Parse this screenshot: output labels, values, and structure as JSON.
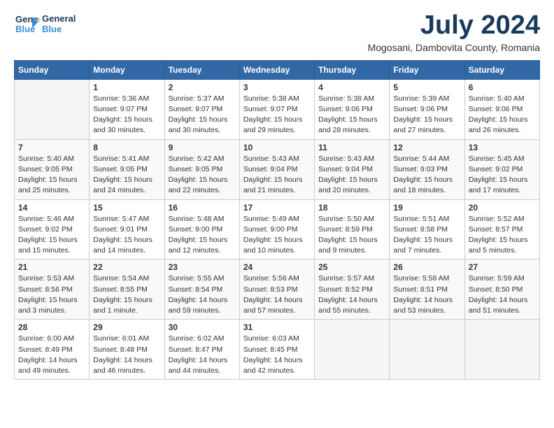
{
  "logo": {
    "line1": "General",
    "line2": "Blue"
  },
  "title": "July 2024",
  "subtitle": "Mogosani, Dambovita County, Romania",
  "days_of_week": [
    "Sunday",
    "Monday",
    "Tuesday",
    "Wednesday",
    "Thursday",
    "Friday",
    "Saturday"
  ],
  "weeks": [
    [
      {
        "day": "",
        "info": ""
      },
      {
        "day": "1",
        "info": "Sunrise: 5:36 AM\nSunset: 9:07 PM\nDaylight: 15 hours\nand 30 minutes."
      },
      {
        "day": "2",
        "info": "Sunrise: 5:37 AM\nSunset: 9:07 PM\nDaylight: 15 hours\nand 30 minutes."
      },
      {
        "day": "3",
        "info": "Sunrise: 5:38 AM\nSunset: 9:07 PM\nDaylight: 15 hours\nand 29 minutes."
      },
      {
        "day": "4",
        "info": "Sunrise: 5:38 AM\nSunset: 9:06 PM\nDaylight: 15 hours\nand 28 minutes."
      },
      {
        "day": "5",
        "info": "Sunrise: 5:39 AM\nSunset: 9:06 PM\nDaylight: 15 hours\nand 27 minutes."
      },
      {
        "day": "6",
        "info": "Sunrise: 5:40 AM\nSunset: 9:06 PM\nDaylight: 15 hours\nand 26 minutes."
      }
    ],
    [
      {
        "day": "7",
        "info": "Sunrise: 5:40 AM\nSunset: 9:05 PM\nDaylight: 15 hours\nand 25 minutes."
      },
      {
        "day": "8",
        "info": "Sunrise: 5:41 AM\nSunset: 9:05 PM\nDaylight: 15 hours\nand 24 minutes."
      },
      {
        "day": "9",
        "info": "Sunrise: 5:42 AM\nSunset: 9:05 PM\nDaylight: 15 hours\nand 22 minutes."
      },
      {
        "day": "10",
        "info": "Sunrise: 5:43 AM\nSunset: 9:04 PM\nDaylight: 15 hours\nand 21 minutes."
      },
      {
        "day": "11",
        "info": "Sunrise: 5:43 AM\nSunset: 9:04 PM\nDaylight: 15 hours\nand 20 minutes."
      },
      {
        "day": "12",
        "info": "Sunrise: 5:44 AM\nSunset: 9:03 PM\nDaylight: 15 hours\nand 18 minutes."
      },
      {
        "day": "13",
        "info": "Sunrise: 5:45 AM\nSunset: 9:02 PM\nDaylight: 15 hours\nand 17 minutes."
      }
    ],
    [
      {
        "day": "14",
        "info": "Sunrise: 5:46 AM\nSunset: 9:02 PM\nDaylight: 15 hours\nand 15 minutes."
      },
      {
        "day": "15",
        "info": "Sunrise: 5:47 AM\nSunset: 9:01 PM\nDaylight: 15 hours\nand 14 minutes."
      },
      {
        "day": "16",
        "info": "Sunrise: 5:48 AM\nSunset: 9:00 PM\nDaylight: 15 hours\nand 12 minutes."
      },
      {
        "day": "17",
        "info": "Sunrise: 5:49 AM\nSunset: 9:00 PM\nDaylight: 15 hours\nand 10 minutes."
      },
      {
        "day": "18",
        "info": "Sunrise: 5:50 AM\nSunset: 8:59 PM\nDaylight: 15 hours\nand 9 minutes."
      },
      {
        "day": "19",
        "info": "Sunrise: 5:51 AM\nSunset: 8:58 PM\nDaylight: 15 hours\nand 7 minutes."
      },
      {
        "day": "20",
        "info": "Sunrise: 5:52 AM\nSunset: 8:57 PM\nDaylight: 15 hours\nand 5 minutes."
      }
    ],
    [
      {
        "day": "21",
        "info": "Sunrise: 5:53 AM\nSunset: 8:56 PM\nDaylight: 15 hours\nand 3 minutes."
      },
      {
        "day": "22",
        "info": "Sunrise: 5:54 AM\nSunset: 8:55 PM\nDaylight: 15 hours\nand 1 minute."
      },
      {
        "day": "23",
        "info": "Sunrise: 5:55 AM\nSunset: 8:54 PM\nDaylight: 14 hours\nand 59 minutes."
      },
      {
        "day": "24",
        "info": "Sunrise: 5:56 AM\nSunset: 8:53 PM\nDaylight: 14 hours\nand 57 minutes."
      },
      {
        "day": "25",
        "info": "Sunrise: 5:57 AM\nSunset: 8:52 PM\nDaylight: 14 hours\nand 55 minutes."
      },
      {
        "day": "26",
        "info": "Sunrise: 5:58 AM\nSunset: 8:51 PM\nDaylight: 14 hours\nand 53 minutes."
      },
      {
        "day": "27",
        "info": "Sunrise: 5:59 AM\nSunset: 8:50 PM\nDaylight: 14 hours\nand 51 minutes."
      }
    ],
    [
      {
        "day": "28",
        "info": "Sunrise: 6:00 AM\nSunset: 8:49 PM\nDaylight: 14 hours\nand 49 minutes."
      },
      {
        "day": "29",
        "info": "Sunrise: 6:01 AM\nSunset: 8:48 PM\nDaylight: 14 hours\nand 46 minutes."
      },
      {
        "day": "30",
        "info": "Sunrise: 6:02 AM\nSunset: 8:47 PM\nDaylight: 14 hours\nand 44 minutes."
      },
      {
        "day": "31",
        "info": "Sunrise: 6:03 AM\nSunset: 8:45 PM\nDaylight: 14 hours\nand 42 minutes."
      },
      {
        "day": "",
        "info": ""
      },
      {
        "day": "",
        "info": ""
      },
      {
        "day": "",
        "info": ""
      }
    ]
  ]
}
